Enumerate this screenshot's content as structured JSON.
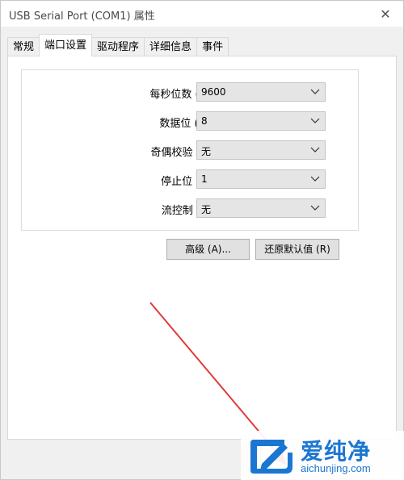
{
  "window": {
    "title": "USB Serial Port (COM1) 属性",
    "close_glyph": "✕"
  },
  "tabs": [
    {
      "label": "常规",
      "active": false
    },
    {
      "label": "端口设置",
      "active": true
    },
    {
      "label": "驱动程序",
      "active": false
    },
    {
      "label": "详细信息",
      "active": false
    },
    {
      "label": "事件",
      "active": false
    }
  ],
  "port_settings": {
    "fields": [
      {
        "label": "每秒位数 (B):",
        "value": "9600"
      },
      {
        "label": "数据位 (D):",
        "value": "8"
      },
      {
        "label": "奇偶校验 (P):",
        "value": "无"
      },
      {
        "label": "停止位 (S):",
        "value": "1"
      },
      {
        "label": "流控制 (F):",
        "value": "无"
      }
    ],
    "advanced_label": "高级 (A)...",
    "restore_defaults_label": "还原默认值 (R)"
  },
  "watermark": {
    "chinese": "爱纯净",
    "url": "aichunjing.com"
  },
  "colors": {
    "annotation_arrow": "#e23b3b",
    "watermark_blue": "#1b76d2"
  }
}
